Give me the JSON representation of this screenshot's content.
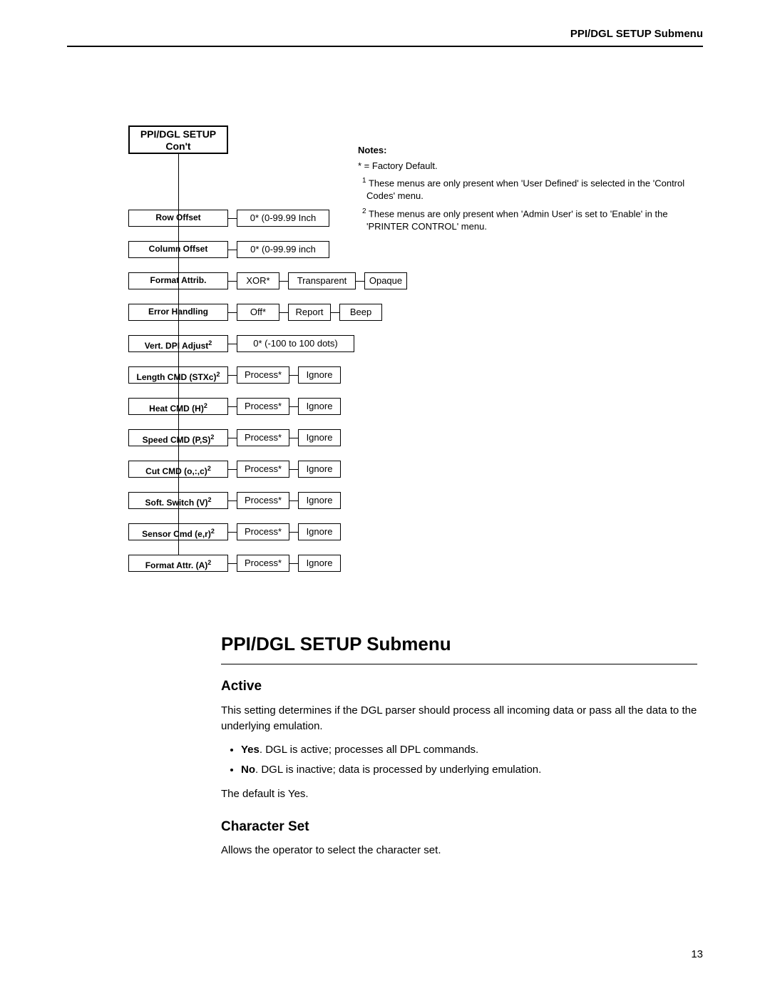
{
  "header": {
    "running": "PPI/DGL SETUP Submenu"
  },
  "diagram": {
    "root_line1": "PPI/DGL SETUP",
    "root_line2": "Con't",
    "rows": [
      {
        "label": "Row Offset",
        "sup": "",
        "opts": [
          "0* (0-99.99 Inch"
        ]
      },
      {
        "label": "Column Offset",
        "sup": "",
        "opts": [
          "0* (0-99.99 inch"
        ]
      },
      {
        "label": "Format Attrib.",
        "sup": "",
        "opts": [
          "XOR*",
          "Transparent",
          "Opaque"
        ]
      },
      {
        "label": "Error Handling",
        "sup": "",
        "opts": [
          "Off*",
          "Report",
          "Beep"
        ]
      },
      {
        "label": "Vert. DPI Adjust",
        "sup": "2",
        "opts": [
          "0* (-100 to 100 dots)"
        ]
      },
      {
        "label": "Length CMD (STXc)",
        "sup": "2",
        "opts": [
          "Process*",
          "Ignore"
        ]
      },
      {
        "label": "Heat CMD (H)",
        "sup": "2",
        "opts": [
          "Process*",
          "Ignore"
        ]
      },
      {
        "label": "Speed CMD (P,S)",
        "sup": "2",
        "opts": [
          "Process*",
          "Ignore"
        ]
      },
      {
        "label": "Cut CMD (o,:,c)",
        "sup": "2",
        "opts": [
          "Process*",
          "Ignore"
        ]
      },
      {
        "label": "Soft. Switch (V)",
        "sup": "2",
        "opts": [
          "Process*",
          "Ignore"
        ]
      },
      {
        "label": "Sensor Cmd (e,r)",
        "sup": "2",
        "opts": [
          "Process*",
          "Ignore"
        ]
      },
      {
        "label": "Format Attr. (A)",
        "sup": "2",
        "opts": [
          "Process*",
          "Ignore"
        ]
      }
    ]
  },
  "notes": {
    "heading": "Notes:",
    "star": "* = Factory Default.",
    "n1": "These menus are only present when 'User Defined' is selected in the 'Control Codes' menu.",
    "n2": "These menus are only present when 'Admin User' is set to 'Enable' in the 'PRINTER CONTROL' menu."
  },
  "section": {
    "title": "PPI/DGL SETUP Submenu",
    "active": {
      "heading": "Active",
      "intro": "This setting determines if the DGL parser should process all incoming data or pass all the data to the underlying emulation.",
      "yes_b": "Yes",
      "yes_t": ". DGL is active; processes all DPL commands.",
      "no_b": "No",
      "no_t": ". DGL is inactive; data is processed by underlying emulation.",
      "default": "The default is Yes."
    },
    "charset": {
      "heading": "Character Set",
      "text": "Allows the operator to select the character set."
    }
  },
  "page_number": "13"
}
